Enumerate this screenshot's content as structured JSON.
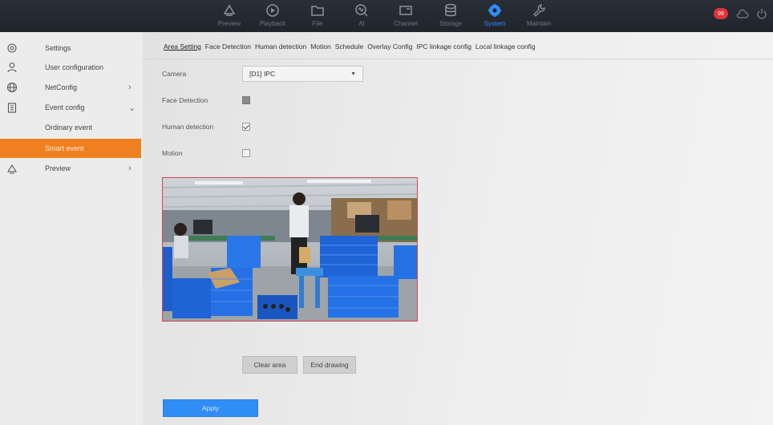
{
  "topnav": {
    "items": [
      {
        "label": "Preview",
        "icon": "preview-icon"
      },
      {
        "label": "Playback",
        "icon": "playback-icon"
      },
      {
        "label": "File",
        "icon": "file-icon"
      },
      {
        "label": "AI",
        "icon": "ai-icon"
      },
      {
        "label": "Channel",
        "icon": "channel-icon"
      },
      {
        "label": "Storage",
        "icon": "storage-icon"
      },
      {
        "label": "System",
        "icon": "system-gear-icon"
      },
      {
        "label": "Maintain",
        "icon": "maintain-wrench-icon"
      }
    ],
    "active_index": 6,
    "alarm_badge": "99"
  },
  "sidebar": {
    "items": [
      {
        "label": "Settings",
        "icon": "settings-icon"
      },
      {
        "label": "User configuration",
        "icon": "user-icon"
      },
      {
        "label": "NetConfig",
        "icon": "globe-icon",
        "chevron": ">"
      },
      {
        "label": "Event config",
        "icon": "clipboard-icon",
        "chevron": "v"
      },
      {
        "label": "Ordinary event"
      },
      {
        "label": "Smart event"
      },
      {
        "label": "Preview",
        "icon": "preview-icon",
        "chevron": ">"
      }
    ],
    "active_index": 5
  },
  "tabs": [
    "Area Setting",
    "Face Detection",
    "Human detection",
    "Motion",
    "Schedule",
    "Overlay Config",
    "IPC linkage config",
    "Local linkage config"
  ],
  "active_tab": 0,
  "form": {
    "camera_label": "Camera",
    "camera_value": "[D1] IPC",
    "face_label": "Face Detection",
    "human_label": "Human detection",
    "motion_label": "Motion"
  },
  "buttons": {
    "clear_area": "Clear area",
    "end_drawing": "End drawing",
    "apply": "Apply"
  },
  "colors": {
    "accent": "#2f8df5",
    "sidebar_active": "#f0801f",
    "area_border": "#d64553"
  }
}
